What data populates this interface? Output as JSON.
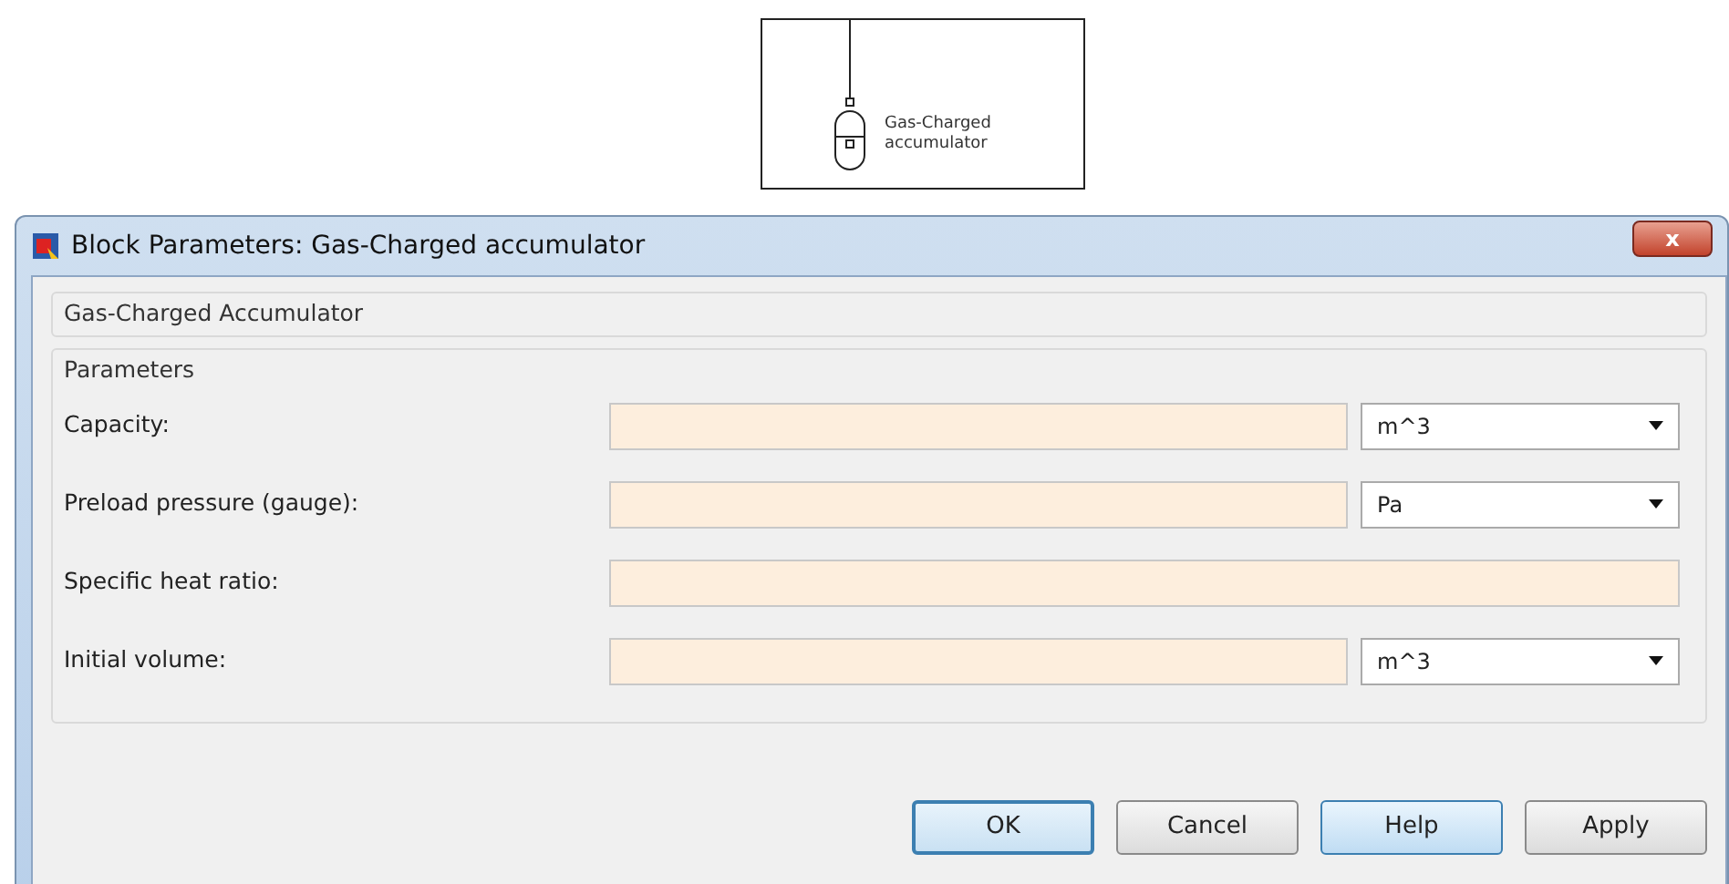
{
  "block": {
    "label_lines": [
      "Gas-Charged",
      "accumulator"
    ]
  },
  "window": {
    "title": "Block Parameters: Gas-Charged accumulator",
    "close": "x"
  },
  "description_group": {
    "title": "Gas-Charged Accumulator"
  },
  "parameters_group": {
    "title": "Parameters",
    "rows": [
      {
        "label": "Capacity:",
        "kind": "unit",
        "unit": "m^3"
      },
      {
        "label": "Preload pressure (gauge):",
        "kind": "unit",
        "unit": "Pa"
      },
      {
        "label": "Specific heat ratio:",
        "kind": "plain"
      },
      {
        "label": "Initial volume:",
        "kind": "unit",
        "unit": "m^3"
      }
    ]
  },
  "buttons": [
    {
      "label": "OK",
      "default": true,
      "hot": false
    },
    {
      "label": "Cancel",
      "default": false,
      "hot": false
    },
    {
      "label": "Help",
      "default": false,
      "hot": true
    },
    {
      "label": "Apply",
      "default": false,
      "hot": false
    }
  ]
}
